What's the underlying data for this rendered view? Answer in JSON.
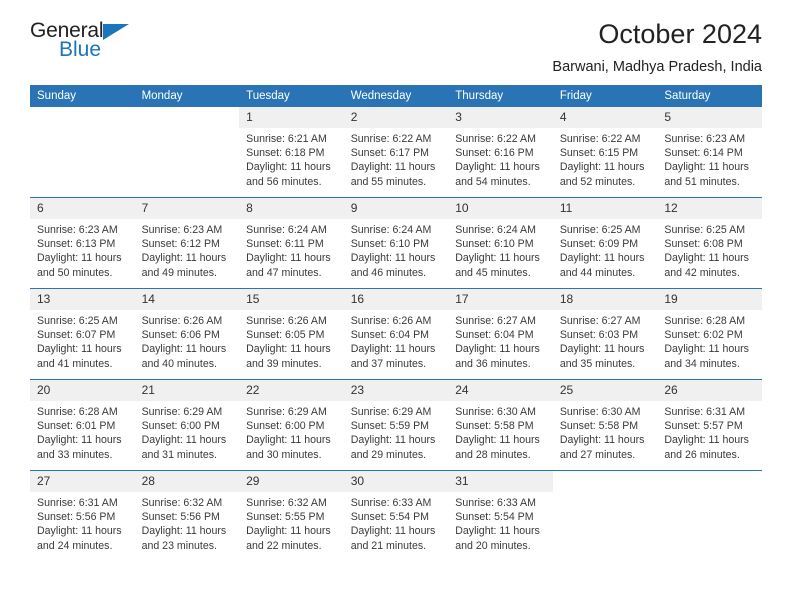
{
  "brand": {
    "name_part1": "General",
    "name_part2": "Blue",
    "triangle_color": "#1b75bb"
  },
  "header": {
    "title": "October 2024",
    "subtitle": "Barwani, Madhya Pradesh, India",
    "accent_color": "#2a74b5",
    "daynum_band_color": "#f0f0f0"
  },
  "weekday_headers": [
    "Sunday",
    "Monday",
    "Tuesday",
    "Wednesday",
    "Thursday",
    "Friday",
    "Saturday"
  ],
  "weeks": [
    [
      {
        "day": "",
        "empty": true,
        "blank": true,
        "sunrise": "",
        "sunset": "",
        "daylight_line1": "",
        "daylight_line2": ""
      },
      {
        "day": "",
        "empty": true,
        "blank": true,
        "sunrise": "",
        "sunset": "",
        "daylight_line1": "",
        "daylight_line2": ""
      },
      {
        "day": "1",
        "sunrise": "Sunrise: 6:21 AM",
        "sunset": "Sunset: 6:18 PM",
        "daylight_line1": "Daylight: 11 hours",
        "daylight_line2": "and 56 minutes."
      },
      {
        "day": "2",
        "sunrise": "Sunrise: 6:22 AM",
        "sunset": "Sunset: 6:17 PM",
        "daylight_line1": "Daylight: 11 hours",
        "daylight_line2": "and 55 minutes."
      },
      {
        "day": "3",
        "sunrise": "Sunrise: 6:22 AM",
        "sunset": "Sunset: 6:16 PM",
        "daylight_line1": "Daylight: 11 hours",
        "daylight_line2": "and 54 minutes."
      },
      {
        "day": "4",
        "sunrise": "Sunrise: 6:22 AM",
        "sunset": "Sunset: 6:15 PM",
        "daylight_line1": "Daylight: 11 hours",
        "daylight_line2": "and 52 minutes."
      },
      {
        "day": "5",
        "sunrise": "Sunrise: 6:23 AM",
        "sunset": "Sunset: 6:14 PM",
        "daylight_line1": "Daylight: 11 hours",
        "daylight_line2": "and 51 minutes."
      }
    ],
    [
      {
        "day": "6",
        "sunrise": "Sunrise: 6:23 AM",
        "sunset": "Sunset: 6:13 PM",
        "daylight_line1": "Daylight: 11 hours",
        "daylight_line2": "and 50 minutes."
      },
      {
        "day": "7",
        "sunrise": "Sunrise: 6:23 AM",
        "sunset": "Sunset: 6:12 PM",
        "daylight_line1": "Daylight: 11 hours",
        "daylight_line2": "and 49 minutes."
      },
      {
        "day": "8",
        "sunrise": "Sunrise: 6:24 AM",
        "sunset": "Sunset: 6:11 PM",
        "daylight_line1": "Daylight: 11 hours",
        "daylight_line2": "and 47 minutes."
      },
      {
        "day": "9",
        "sunrise": "Sunrise: 6:24 AM",
        "sunset": "Sunset: 6:10 PM",
        "daylight_line1": "Daylight: 11 hours",
        "daylight_line2": "and 46 minutes."
      },
      {
        "day": "10",
        "sunrise": "Sunrise: 6:24 AM",
        "sunset": "Sunset: 6:10 PM",
        "daylight_line1": "Daylight: 11 hours",
        "daylight_line2": "and 45 minutes."
      },
      {
        "day": "11",
        "sunrise": "Sunrise: 6:25 AM",
        "sunset": "Sunset: 6:09 PM",
        "daylight_line1": "Daylight: 11 hours",
        "daylight_line2": "and 44 minutes."
      },
      {
        "day": "12",
        "sunrise": "Sunrise: 6:25 AM",
        "sunset": "Sunset: 6:08 PM",
        "daylight_line1": "Daylight: 11 hours",
        "daylight_line2": "and 42 minutes."
      }
    ],
    [
      {
        "day": "13",
        "sunrise": "Sunrise: 6:25 AM",
        "sunset": "Sunset: 6:07 PM",
        "daylight_line1": "Daylight: 11 hours",
        "daylight_line2": "and 41 minutes."
      },
      {
        "day": "14",
        "sunrise": "Sunrise: 6:26 AM",
        "sunset": "Sunset: 6:06 PM",
        "daylight_line1": "Daylight: 11 hours",
        "daylight_line2": "and 40 minutes."
      },
      {
        "day": "15",
        "sunrise": "Sunrise: 6:26 AM",
        "sunset": "Sunset: 6:05 PM",
        "daylight_line1": "Daylight: 11 hours",
        "daylight_line2": "and 39 minutes."
      },
      {
        "day": "16",
        "sunrise": "Sunrise: 6:26 AM",
        "sunset": "Sunset: 6:04 PM",
        "daylight_line1": "Daylight: 11 hours",
        "daylight_line2": "and 37 minutes."
      },
      {
        "day": "17",
        "sunrise": "Sunrise: 6:27 AM",
        "sunset": "Sunset: 6:04 PM",
        "daylight_line1": "Daylight: 11 hours",
        "daylight_line2": "and 36 minutes."
      },
      {
        "day": "18",
        "sunrise": "Sunrise: 6:27 AM",
        "sunset": "Sunset: 6:03 PM",
        "daylight_line1": "Daylight: 11 hours",
        "daylight_line2": "and 35 minutes."
      },
      {
        "day": "19",
        "sunrise": "Sunrise: 6:28 AM",
        "sunset": "Sunset: 6:02 PM",
        "daylight_line1": "Daylight: 11 hours",
        "daylight_line2": "and 34 minutes."
      }
    ],
    [
      {
        "day": "20",
        "sunrise": "Sunrise: 6:28 AM",
        "sunset": "Sunset: 6:01 PM",
        "daylight_line1": "Daylight: 11 hours",
        "daylight_line2": "and 33 minutes."
      },
      {
        "day": "21",
        "sunrise": "Sunrise: 6:29 AM",
        "sunset": "Sunset: 6:00 PM",
        "daylight_line1": "Daylight: 11 hours",
        "daylight_line2": "and 31 minutes."
      },
      {
        "day": "22",
        "sunrise": "Sunrise: 6:29 AM",
        "sunset": "Sunset: 6:00 PM",
        "daylight_line1": "Daylight: 11 hours",
        "daylight_line2": "and 30 minutes."
      },
      {
        "day": "23",
        "sunrise": "Sunrise: 6:29 AM",
        "sunset": "Sunset: 5:59 PM",
        "daylight_line1": "Daylight: 11 hours",
        "daylight_line2": "and 29 minutes."
      },
      {
        "day": "24",
        "sunrise": "Sunrise: 6:30 AM",
        "sunset": "Sunset: 5:58 PM",
        "daylight_line1": "Daylight: 11 hours",
        "daylight_line2": "and 28 minutes."
      },
      {
        "day": "25",
        "sunrise": "Sunrise: 6:30 AM",
        "sunset": "Sunset: 5:58 PM",
        "daylight_line1": "Daylight: 11 hours",
        "daylight_line2": "and 27 minutes."
      },
      {
        "day": "26",
        "sunrise": "Sunrise: 6:31 AM",
        "sunset": "Sunset: 5:57 PM",
        "daylight_line1": "Daylight: 11 hours",
        "daylight_line2": "and 26 minutes."
      }
    ],
    [
      {
        "day": "27",
        "sunrise": "Sunrise: 6:31 AM",
        "sunset": "Sunset: 5:56 PM",
        "daylight_line1": "Daylight: 11 hours",
        "daylight_line2": "and 24 minutes."
      },
      {
        "day": "28",
        "sunrise": "Sunrise: 6:32 AM",
        "sunset": "Sunset: 5:56 PM",
        "daylight_line1": "Daylight: 11 hours",
        "daylight_line2": "and 23 minutes."
      },
      {
        "day": "29",
        "sunrise": "Sunrise: 6:32 AM",
        "sunset": "Sunset: 5:55 PM",
        "daylight_line1": "Daylight: 11 hours",
        "daylight_line2": "and 22 minutes."
      },
      {
        "day": "30",
        "sunrise": "Sunrise: 6:33 AM",
        "sunset": "Sunset: 5:54 PM",
        "daylight_line1": "Daylight: 11 hours",
        "daylight_line2": "and 21 minutes."
      },
      {
        "day": "31",
        "sunrise": "Sunrise: 6:33 AM",
        "sunset": "Sunset: 5:54 PM",
        "daylight_line1": "Daylight: 11 hours",
        "daylight_line2": "and 20 minutes."
      },
      {
        "day": "",
        "empty": true,
        "blank": true,
        "sunrise": "",
        "sunset": "",
        "daylight_line1": "",
        "daylight_line2": ""
      },
      {
        "day": "",
        "empty": true,
        "blank": true,
        "sunrise": "",
        "sunset": "",
        "daylight_line1": "",
        "daylight_line2": ""
      }
    ]
  ]
}
